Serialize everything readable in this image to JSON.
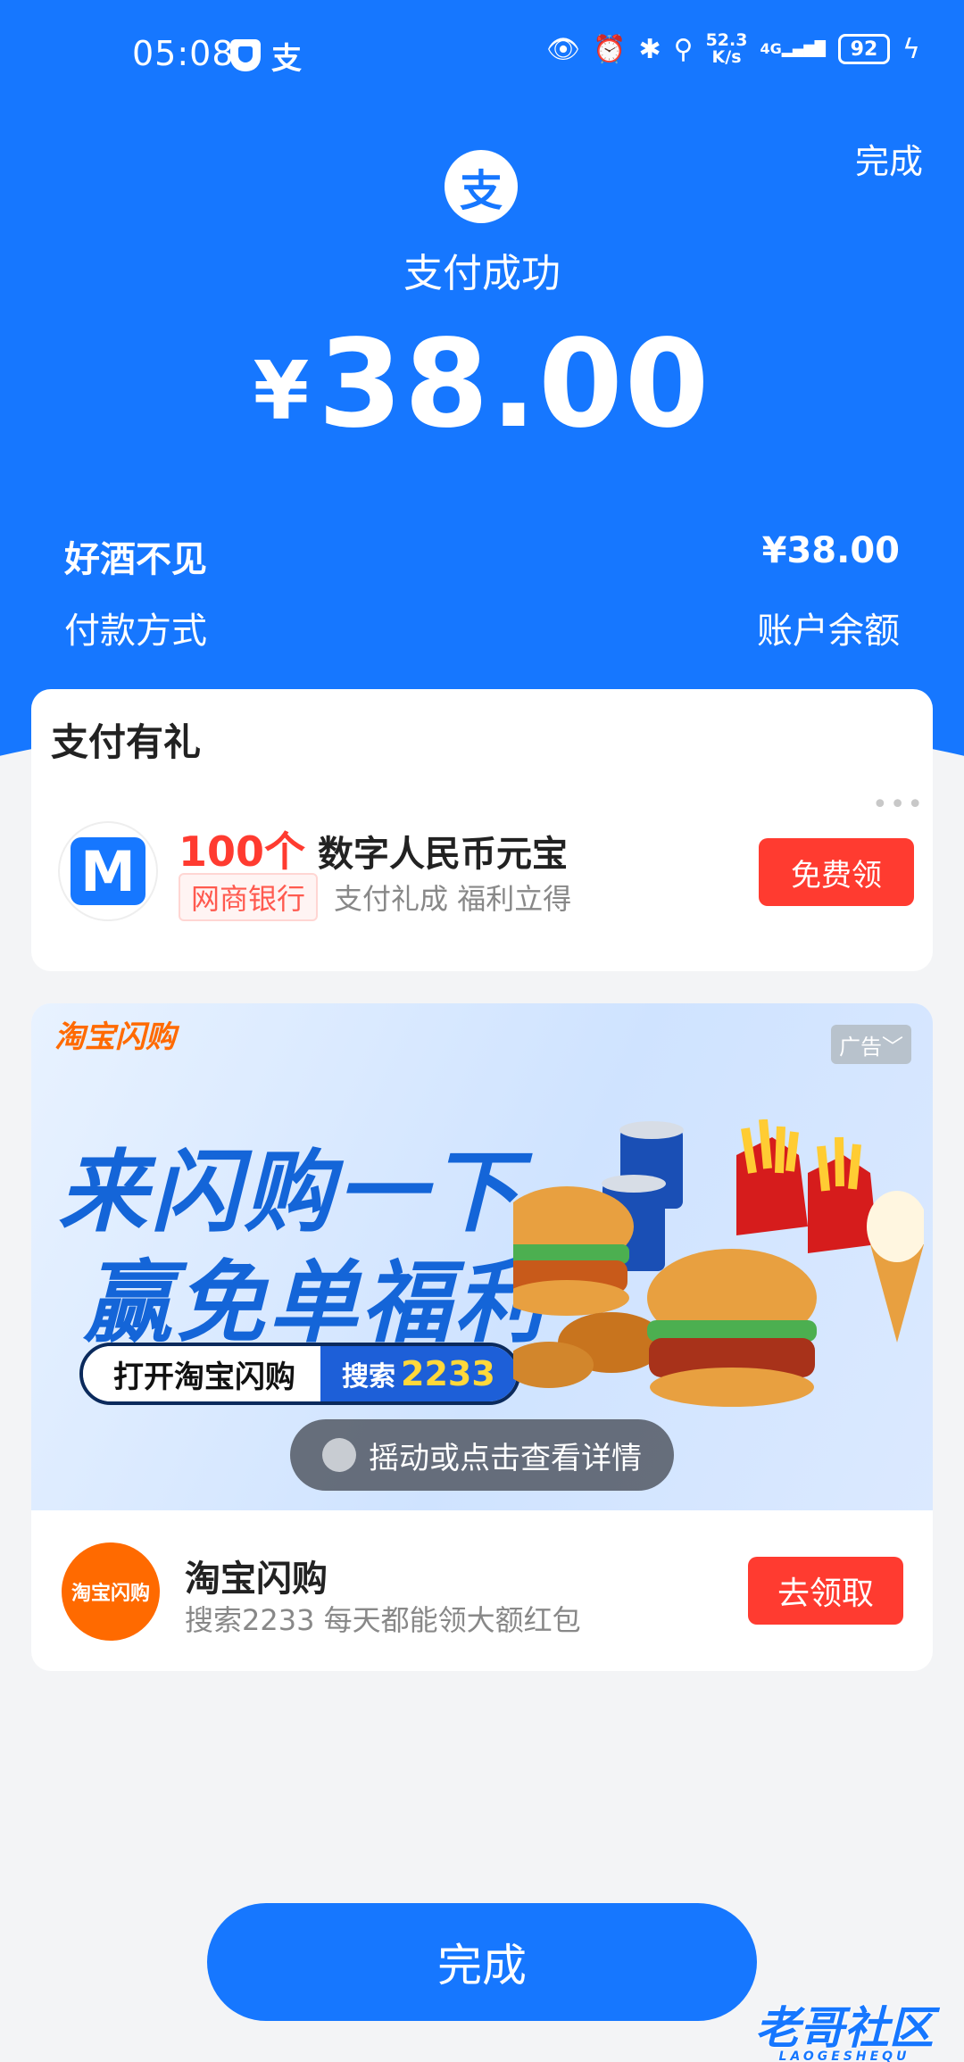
{
  "status_bar": {
    "time": "05:08",
    "net_speed_value": "52.3",
    "net_speed_unit": "K/s",
    "network": "4G",
    "battery": "92"
  },
  "header": {
    "done_label": "完成",
    "title": "支付成功",
    "currency": "¥",
    "amount": "38.00"
  },
  "details": {
    "merchant": "好酒不见",
    "merchant_amount": "¥38.00",
    "payment_method_label": "付款方式",
    "payment_method_value": "账户余额"
  },
  "gift_card": {
    "title": "支付有礼",
    "count": "100个",
    "product": "数字人民币元宝",
    "bank_tag": "网商银行",
    "subtitle": "支付礼成 福利立得",
    "button": "免费领"
  },
  "ad_card": {
    "banner_brand": "淘宝闪购",
    "ad_label": "广告",
    "headline_1": "来闪购一下",
    "headline_2": "赢免单福利",
    "pill_text": "打开淘宝闪购",
    "pill_search": "搜索",
    "pill_code": "2233",
    "shake_text": "摇动或点击查看详情",
    "logo_text": "淘宝闪购",
    "name": "淘宝闪购",
    "subtitle": "搜索2233 每天都能领大额红包",
    "button": "去领取"
  },
  "footer": {
    "done_label": "完成"
  },
  "watermark": {
    "text": "老哥社区",
    "sub": "LAOGESHEQU"
  }
}
